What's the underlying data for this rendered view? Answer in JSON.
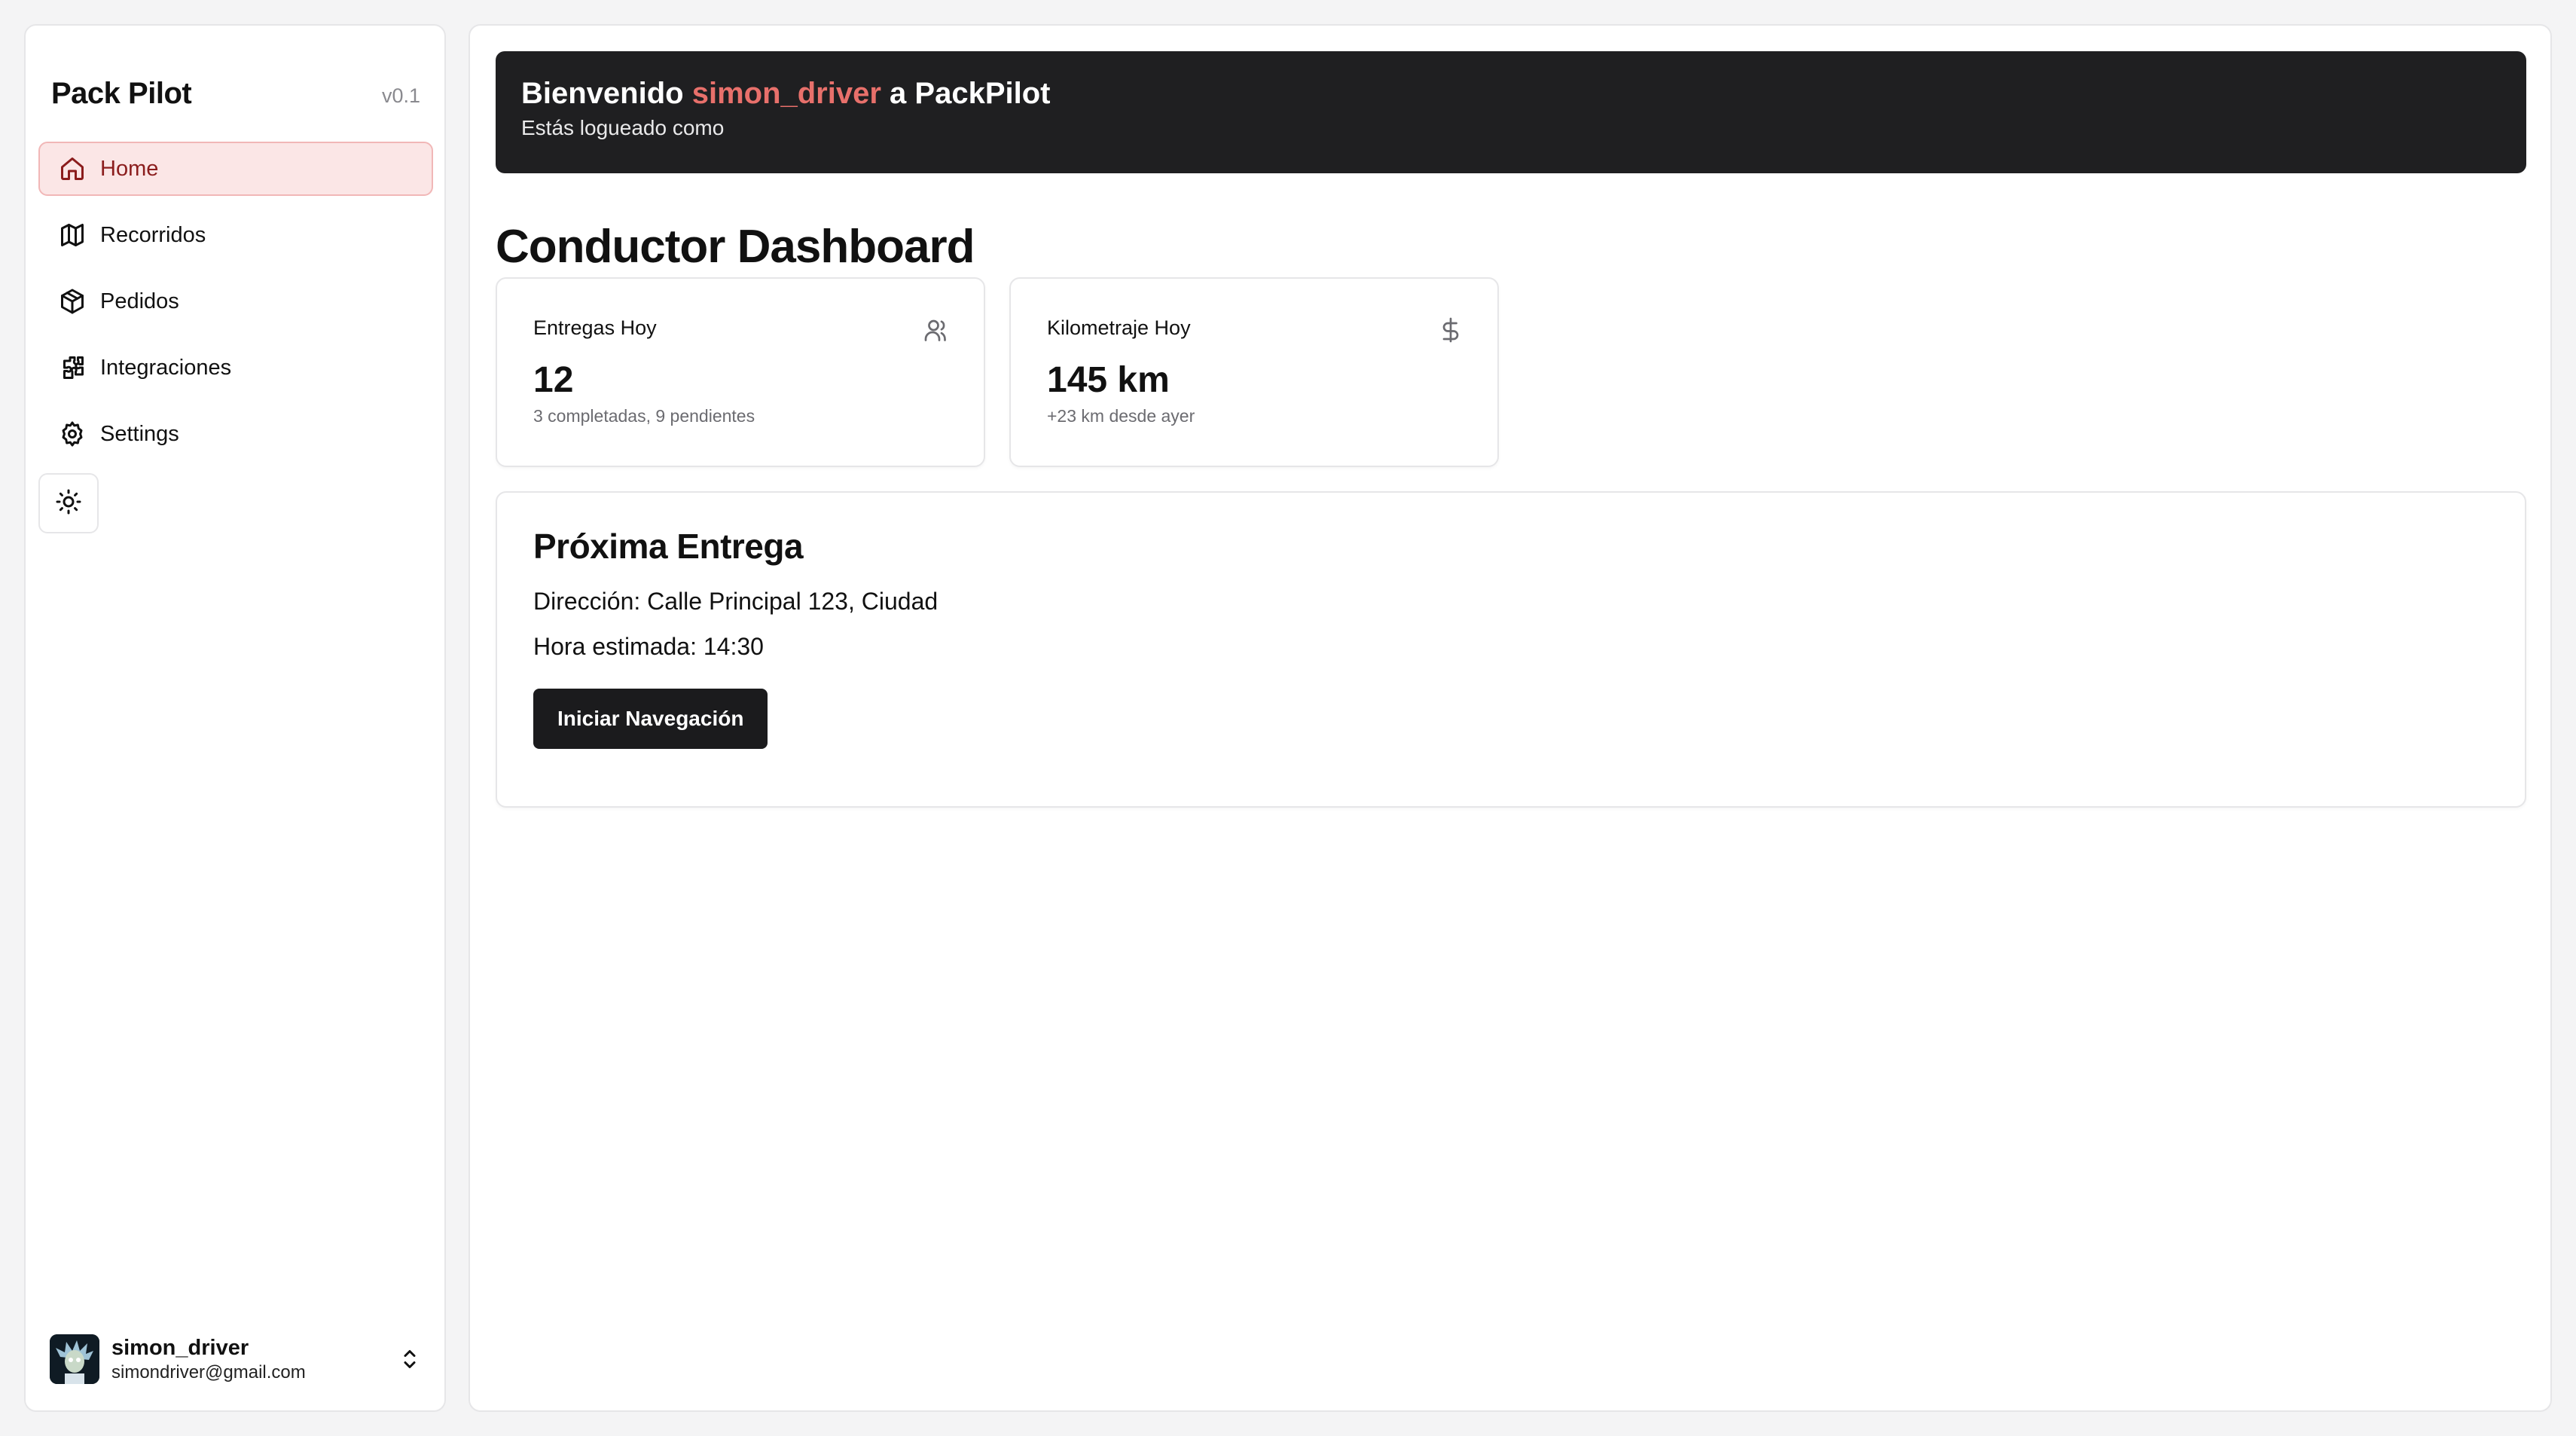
{
  "sidebar": {
    "brand": "Pack Pilot",
    "version": "v0.1",
    "items": [
      {
        "label": "Home",
        "icon": "home-icon"
      },
      {
        "label": "Recorridos",
        "icon": "map-icon"
      },
      {
        "label": "Pedidos",
        "icon": "package-icon"
      },
      {
        "label": "Integraciones",
        "icon": "puzzle-icon"
      },
      {
        "label": "Settings",
        "icon": "gear-icon"
      }
    ],
    "active_item": "Home",
    "theme_toggle_icon": "sun-icon",
    "user": {
      "name": "simon_driver",
      "email": "simondriver@gmail.com"
    }
  },
  "banner": {
    "prefix": "Bienvenido ",
    "username": "simon_driver",
    "suffix": " a PackPilot",
    "subtitle": "Estás logueado como"
  },
  "page_title": "Conductor Dashboard",
  "stats": [
    {
      "label": "Entregas Hoy",
      "value": "12",
      "sub": "3 completadas, 9 pendientes",
      "icon": "users-icon"
    },
    {
      "label": "Kilometraje Hoy",
      "value": "145 km",
      "sub": "+23 km desde ayer",
      "icon": "dollar-icon"
    }
  ],
  "next_delivery": {
    "title": "Próxima Entrega",
    "address": "Dirección: Calle Principal 123, Ciudad",
    "eta": "Hora estimada: 14:30",
    "button": "Iniciar Navegación"
  },
  "colors": {
    "accent": "#e8706b",
    "active_bg": "#fbe6e6",
    "banner_bg": "#1f1f21",
    "button_bg": "#1b1b1d"
  }
}
